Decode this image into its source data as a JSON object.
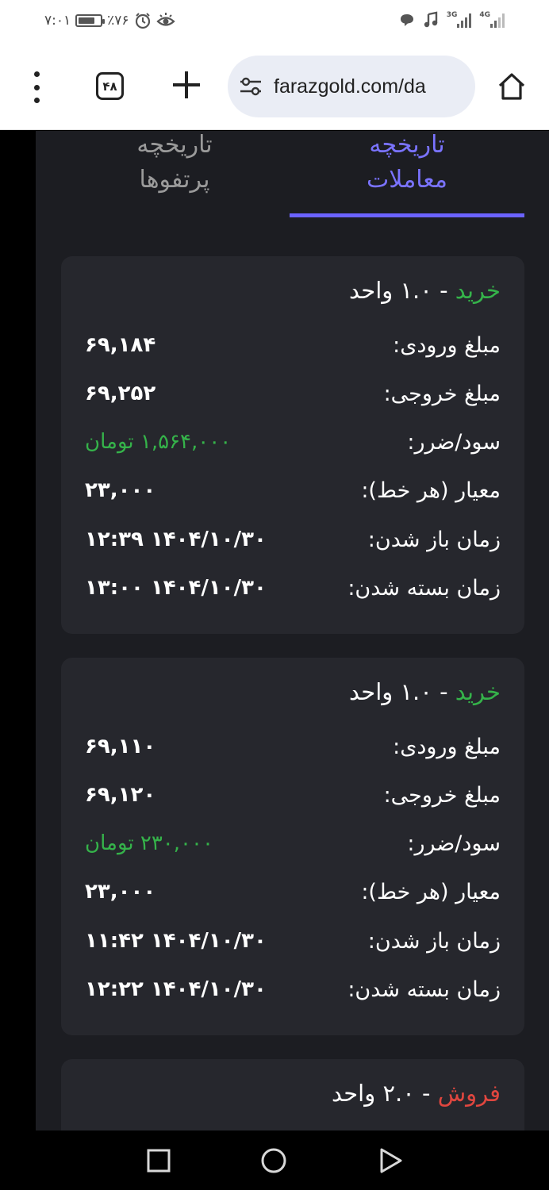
{
  "status_bar": {
    "time": "۷:۰۱",
    "battery": "٪۷۶",
    "battery_level": 0.76,
    "net_3g": "3G",
    "net_4g": "4G"
  },
  "browser": {
    "tab_count": "۴۸",
    "url": "farazgold.com/da"
  },
  "tabs": {
    "trades_history": [
      "تاریخچه",
      "معاملات"
    ],
    "portfolio_history": [
      "تاریخچه",
      "پرتفوها"
    ],
    "active": "trades_history"
  },
  "colors": {
    "buy": "#35b34a",
    "sell": "#e0463f",
    "accent": "#6b63ff",
    "card_bg": "#26272d"
  },
  "labels": {
    "entry": "مبلغ ورودی:",
    "exit": "مبلغ خروجی:",
    "pnl": "سود/ضرر:",
    "criterion": "معیار (هر خط):",
    "open_time": "زمان باز شدن:",
    "close_time": "زمان بسته شدن:"
  },
  "trades": [
    {
      "side": "خرید",
      "side_type": "buy",
      "qty": " - ۱.۰ واحد",
      "entry": "۶۹,۱۸۴",
      "exit": "۶۹,۲۵۲",
      "pnl": "۱,۵۶۴,۰۰۰ تومان",
      "criterion": "۲۳,۰۰۰",
      "open_time": "۱۴۰۴/۱۰/۳۰ ۱۲:۳۹",
      "close_time": "۱۴۰۴/۱۰/۳۰ ۱۳:۰۰"
    },
    {
      "side": "خرید",
      "side_type": "buy",
      "qty": " - ۱.۰ واحد",
      "entry": "۶۹,۱۱۰",
      "exit": "۶۹,۱۲۰",
      "pnl": "۲۳۰,۰۰۰ تومان",
      "criterion": "۲۳,۰۰۰",
      "open_time": "۱۴۰۴/۱۰/۳۰ ۱۱:۴۲",
      "close_time": "۱۴۰۴/۱۰/۳۰ ۱۲:۲۲"
    },
    {
      "side": "فروش",
      "side_type": "sell",
      "qty": " - ۲.۰ واحد"
    }
  ]
}
